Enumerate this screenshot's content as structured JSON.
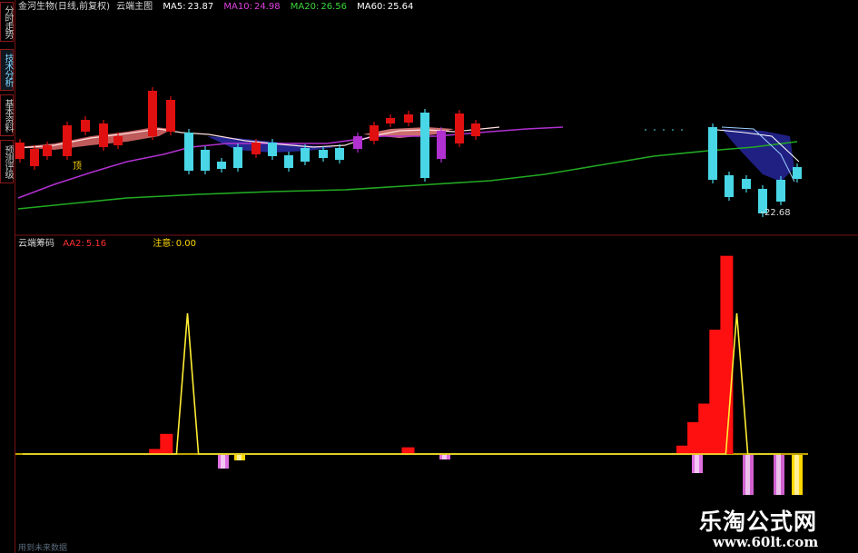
{
  "sidebar": {
    "tabs": [
      {
        "label": "分时走势",
        "active": false
      },
      {
        "label": "技术分析",
        "active": true
      },
      {
        "label": "基本资料",
        "active": false
      },
      {
        "label": "预测评级",
        "active": false
      }
    ]
  },
  "main_header": {
    "title": "金河生物(日线,前复权)",
    "indicator": "云端主图",
    "ma5_label": "MA5:",
    "ma5_value": "23.87",
    "ma10_label": "MA10:",
    "ma10_value": "24.98",
    "ma20_label": "MA20:",
    "ma20_value": "26.56",
    "ma60_label": "MA60:",
    "ma60_value": "25.64"
  },
  "main_chart": {
    "low_marker": "22.68",
    "signal_label": "顶"
  },
  "sub_header": {
    "name": "云端筹码",
    "aa2_label": "AA2:",
    "aa2_value": "5.16",
    "note_label": "注意:",
    "note_value": "0.00"
  },
  "watermark": {
    "title": "乐淘公式网",
    "url": "www.60lt.com"
  },
  "footer": {
    "text": "用到未来数据"
  },
  "colors": {
    "up": "#e01010",
    "down": "#49d6e6",
    "ma5": "#ffffff",
    "ma10": "#c020c0",
    "ma20": "#22aa22",
    "ma60": "#ffd700",
    "aa2": "#ff3030",
    "note": "#ffd700",
    "purple": "#b030d0",
    "border": "#7a1111"
  },
  "sub_series": {
    "red_bars": [
      0,
      0,
      0,
      0,
      0,
      0,
      0,
      0,
      0,
      0,
      0,
      0,
      0.3,
      1.2,
      0,
      0,
      0,
      0,
      0,
      0,
      0,
      0,
      0,
      0,
      0,
      0,
      0,
      0,
      0,
      0,
      0,
      0,
      0,
      0,
      0,
      0.4,
      0,
      0,
      0,
      0,
      0,
      0,
      0,
      0,
      0,
      0,
      0,
      0,
      0,
      0,
      0,
      0,
      0,
      0,
      0,
      0,
      0,
      0,
      0,
      0,
      0.5,
      1.9,
      3.0,
      7.4,
      11.8,
      0,
      0,
      0,
      0,
      0
    ],
    "yellow_line": [
      0,
      0,
      0,
      0,
      0,
      0,
      0,
      0,
      0,
      0,
      0,
      0,
      0,
      0,
      0,
      6.2,
      0,
      0,
      0,
      0,
      0,
      0,
      0,
      0,
      0,
      0,
      0,
      0,
      0,
      0,
      0,
      0,
      0,
      0,
      0,
      0,
      0,
      0,
      0,
      0,
      0,
      0,
      0,
      0,
      0,
      0,
      0,
      0,
      0,
      0,
      0,
      0,
      0,
      0,
      0,
      0,
      0,
      0,
      0,
      0,
      0,
      0,
      0,
      0,
      0,
      6.2,
      0,
      0,
      0,
      0
    ]
  }
}
